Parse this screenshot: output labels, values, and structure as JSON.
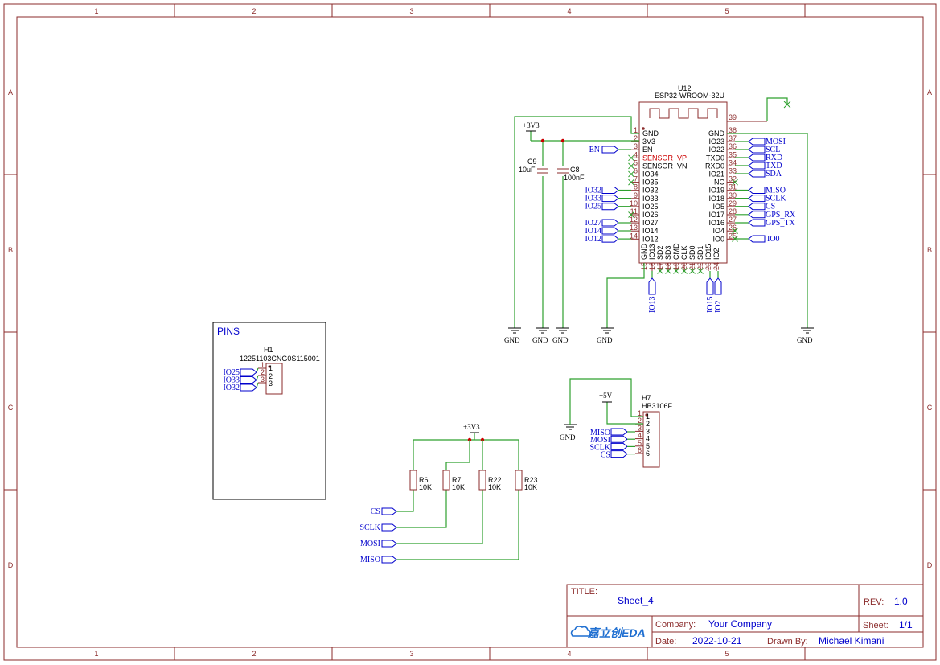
{
  "frame": {
    "cols": [
      "1",
      "2",
      "3",
      "4",
      "5"
    ],
    "rows": [
      "A",
      "B",
      "C",
      "D"
    ]
  },
  "u12": {
    "ref": "U12",
    "part": "ESP32-WROOM-32U",
    "left_pins": [
      {
        "n": "1",
        "name": "GND"
      },
      {
        "n": "2",
        "name": "3V3"
      },
      {
        "n": "3",
        "name": "EN"
      },
      {
        "n": "4",
        "name": "SENSOR_VP",
        "red": true
      },
      {
        "n": "5",
        "name": "SENSOR_VN"
      },
      {
        "n": "6",
        "name": "IO34"
      },
      {
        "n": "7",
        "name": "IO35"
      },
      {
        "n": "8",
        "name": "IO32"
      },
      {
        "n": "9",
        "name": "IO33"
      },
      {
        "n": "10",
        "name": "IO25"
      },
      {
        "n": "11",
        "name": "IO26"
      },
      {
        "n": "12",
        "name": "IO27"
      },
      {
        "n": "13",
        "name": "IO14"
      },
      {
        "n": "14",
        "name": "IO12"
      }
    ],
    "right_pins": [
      {
        "n": "38",
        "name": "GND"
      },
      {
        "n": "37",
        "name": "IO23"
      },
      {
        "n": "36",
        "name": "IO22"
      },
      {
        "n": "35",
        "name": "TXD0"
      },
      {
        "n": "34",
        "name": "RXD0"
      },
      {
        "n": "33",
        "name": "IO21"
      },
      {
        "n": "32",
        "name": "NC"
      },
      {
        "n": "31",
        "name": "IO19"
      },
      {
        "n": "30",
        "name": "IO18"
      },
      {
        "n": "29",
        "name": "IO5"
      },
      {
        "n": "28",
        "name": "IO17"
      },
      {
        "n": "27",
        "name": "IO16"
      },
      {
        "n": "26",
        "name": "IO4"
      },
      {
        "n": "25",
        "name": "IO0"
      }
    ],
    "bottom_pins": [
      {
        "n": "15",
        "name": "GND"
      },
      {
        "n": "16",
        "name": "IO13"
      },
      {
        "n": "17",
        "name": "SD2"
      },
      {
        "n": "18",
        "name": "SD3"
      },
      {
        "n": "19",
        "name": "CMD"
      },
      {
        "n": "20",
        "name": "CLK"
      },
      {
        "n": "21",
        "name": "SD0"
      },
      {
        "n": "22",
        "name": "SD1"
      },
      {
        "n": "23",
        "name": "IO15"
      },
      {
        "n": "24",
        "name": "IO2"
      }
    ],
    "pin39": "39"
  },
  "u12_left_flags": {
    "en": "EN",
    "io32": "IO32",
    "io33": "IO33",
    "io25": "IO25",
    "io27": "IO27",
    "io14": "IO14",
    "io12": "IO12"
  },
  "u12_right_flags": {
    "mosi": "MOSI",
    "scl": "SCL",
    "rxd": "RXD",
    "txd": "TXD",
    "sda": "SDA",
    "miso": "MISO",
    "sclk": "SCLK",
    "cs": "CS",
    "gps_rx": "GPS_RX",
    "gps_tx": "GPS_TX",
    "io0": "IO0"
  },
  "u12_bottom_flags": {
    "io13": "IO13",
    "io15": "IO15",
    "io2": "IO2"
  },
  "power": {
    "v33": "+3V3",
    "v5": "+5V",
    "gnd": "GND"
  },
  "c9": {
    "ref": "C9",
    "value": "10uF"
  },
  "c8": {
    "ref": "C8",
    "value": "100nF"
  },
  "pins_box": {
    "title": "PINS"
  },
  "h1": {
    "ref": "H1",
    "part": "12251103CNG0S115001",
    "pins": [
      "1",
      "2",
      "3"
    ],
    "flags": [
      "IO25",
      "IO33",
      "IO32"
    ]
  },
  "h7": {
    "ref": "H7",
    "part": "HB3106F",
    "pins": [
      "1",
      "2",
      "3",
      "4",
      "5",
      "6"
    ],
    "flags": [
      "MISO",
      "MOSI",
      "SCLK",
      "CS"
    ]
  },
  "resistors": [
    {
      "ref": "R6",
      "value": "10K"
    },
    {
      "ref": "R7",
      "value": "10K"
    },
    {
      "ref": "R22",
      "value": "10K"
    },
    {
      "ref": "R23",
      "value": "10K"
    }
  ],
  "pullup_flags": [
    "CS",
    "SCLK",
    "MOSI",
    "MISO"
  ],
  "titleblock": {
    "title_label": "TITLE:",
    "title": "Sheet_4",
    "rev_label": "REV:",
    "rev": "1.0",
    "logo": "嘉立创EDA",
    "company_label": "Company:",
    "company": "Your Company",
    "sheet_label": "Sheet:",
    "sheet": "1/1",
    "date_label": "Date:",
    "date": "2022-10-21",
    "drawn_label": "Drawn By:",
    "drawn": "Michael Kimani"
  }
}
